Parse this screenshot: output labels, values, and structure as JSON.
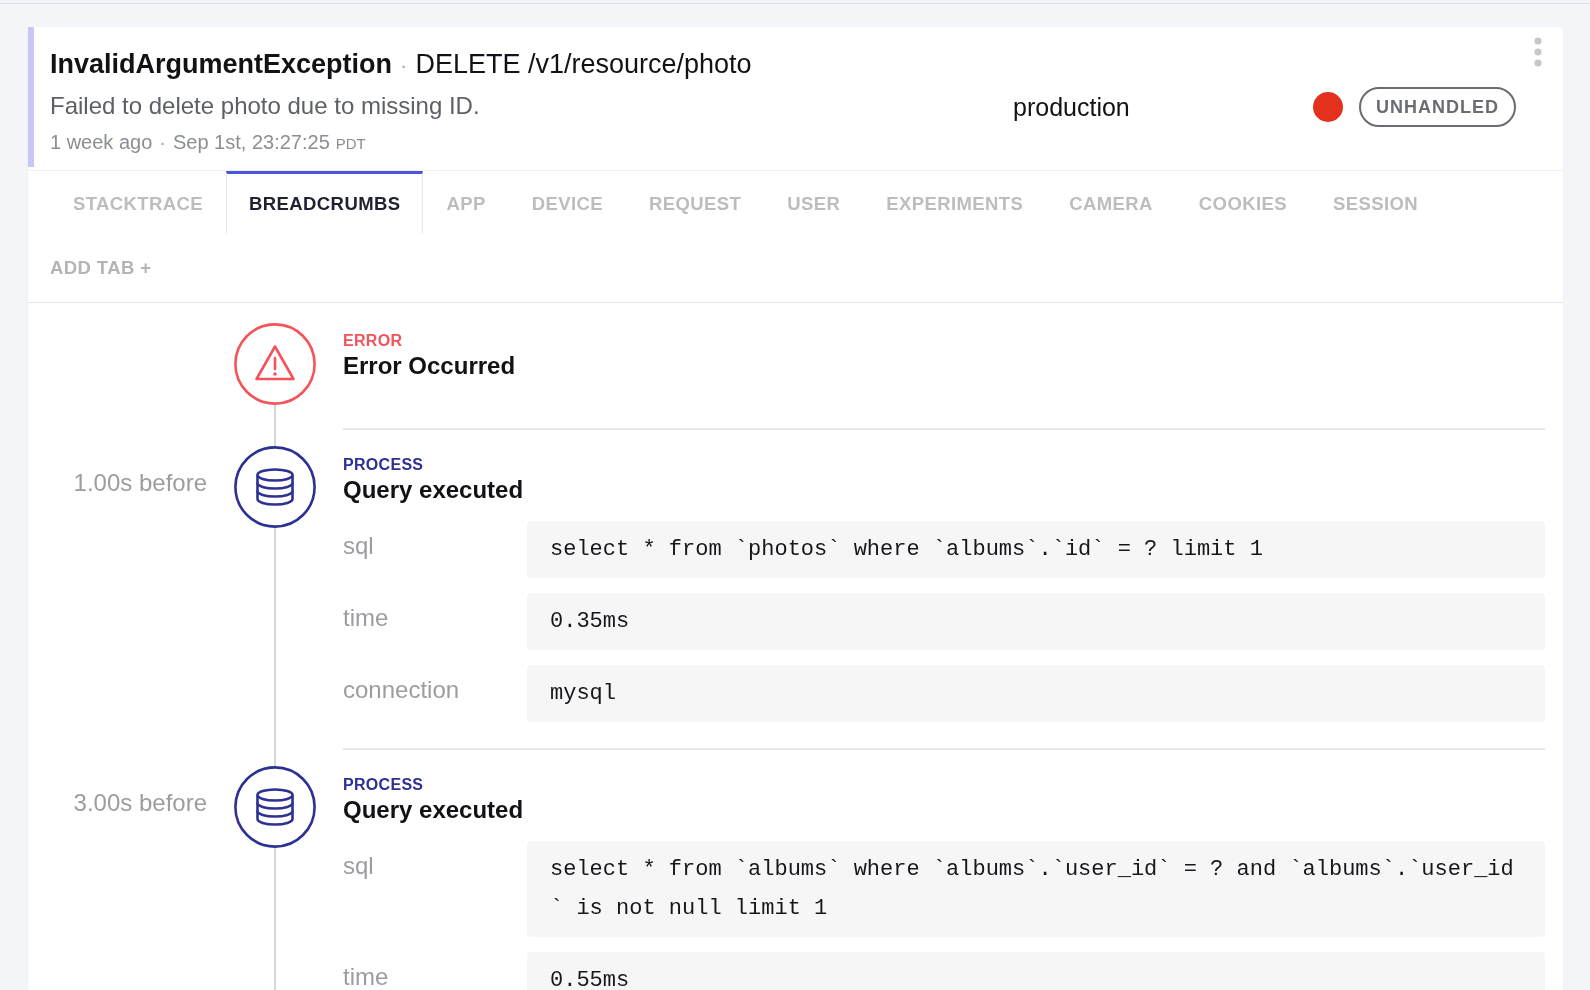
{
  "error": {
    "class": "InvalidArgumentException",
    "separator": "·",
    "context": "DELETE /v1/resource/photo",
    "message": "Failed to delete photo due to missing ID.",
    "relative_time": "1 week ago",
    "time_separator": "·",
    "timestamp": "Sep 1st, 23:27:25",
    "timezone": "PDT",
    "release_stage": "production",
    "severity_dot": {
      "color": "#e3311d"
    },
    "handled_state": "UNHANDLED"
  },
  "tabs": [
    {
      "label": "STACKTRACE",
      "selected": false
    },
    {
      "label": "BREADCRUMBS",
      "selected": true
    },
    {
      "label": "APP",
      "selected": false
    },
    {
      "label": "DEVICE",
      "selected": false
    },
    {
      "label": "REQUEST",
      "selected": false
    },
    {
      "label": "USER",
      "selected": false
    },
    {
      "label": "EXPERIMENTS",
      "selected": false
    },
    {
      "label": "CAMERA",
      "selected": false
    },
    {
      "label": "COOKIES",
      "selected": false
    },
    {
      "label": "SESSION",
      "selected": false
    }
  ],
  "add_tab": "ADD TAB +",
  "breadcrumbs": [
    {
      "kind": "error",
      "category": "ERROR",
      "title": "Error Occurred"
    },
    {
      "kind": "process",
      "time_label": "1.00s before",
      "category": "PROCESS",
      "title": "Query executed",
      "metadata": [
        {
          "key": "sql",
          "value": "select * from `photos` where `albums`.`id` = ? limit 1"
        },
        {
          "key": "time",
          "value": "0.35ms"
        },
        {
          "key": "connection",
          "value": "mysql"
        }
      ]
    },
    {
      "kind": "process",
      "time_label": "3.00s before",
      "category": "PROCESS",
      "title": "Query executed",
      "metadata": [
        {
          "key": "sql",
          "value": "select * from `albums` where `albums`.`user_id` = ? and `albums`.`user_id` is not null limit 1"
        },
        {
          "key": "time",
          "value": "0.55ms"
        }
      ]
    }
  ]
}
